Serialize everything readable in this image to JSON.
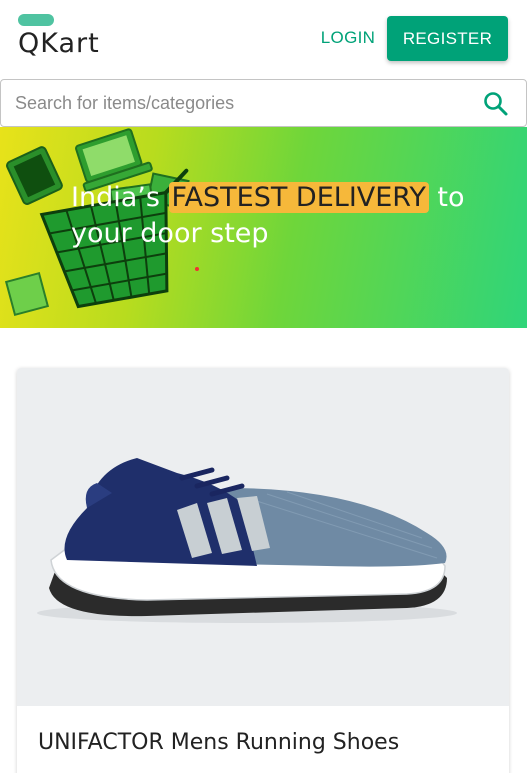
{
  "header": {
    "logo_text": "QKart",
    "login_label": "LOGIN",
    "register_label": "REGISTER"
  },
  "search": {
    "placeholder": "Search for items/categories",
    "value": "",
    "icon": "search-icon"
  },
  "hero": {
    "text_before": "India’s ",
    "highlight": "FASTEST DELIVERY",
    "text_after": " to your door step"
  },
  "products": [
    {
      "name": "UNIFACTOR Mens Running Shoes",
      "image_icon": "running-shoe-image"
    }
  ],
  "colors": {
    "primary": "#00a278",
    "logo_accent": "#4fc3a1",
    "highlight": "#f6b83a"
  }
}
